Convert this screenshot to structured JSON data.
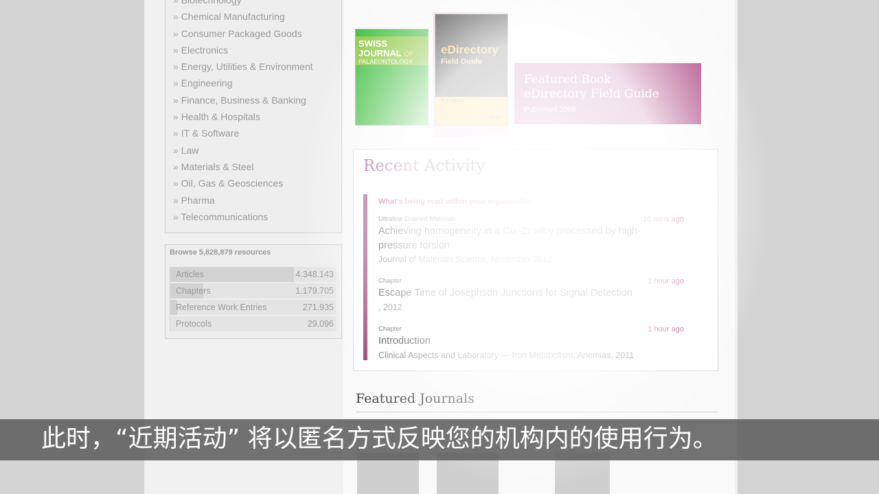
{
  "sidebar": {
    "categories": [
      "Biotechnology",
      "Chemical Manufacturing",
      "Consumer Packaged Goods",
      "Electronics",
      "Energy, Utilities & Environment",
      "Engineering",
      "Finance, Business & Banking",
      "Health & Hospitals",
      "IT & Software",
      "Law",
      "Materials & Steel",
      "Oil, Gas & Geosciences",
      "Pharma",
      "Telecommunications"
    ],
    "browse": {
      "title": "Browse 5,828,879 resources",
      "rows": [
        {
          "label": "Articles",
          "count": "4.348.143",
          "share": 0.746
        },
        {
          "label": "Chapters",
          "count": "1.179.705",
          "share": 0.202
        },
        {
          "label": "Reference Work Entries",
          "count": "271.935",
          "share": 0.047
        },
        {
          "label": "Protocols",
          "count": "29.096",
          "share": 0.005
        }
      ]
    }
  },
  "covers": {
    "swiss": {
      "line1": "SWISS",
      "line2": "JOURNAL",
      "line3": "OF",
      "line4": "PALAEONTOLOGY"
    },
    "edirectory": {
      "title": "eDirectory",
      "subtitle": "Field Guide",
      "author": "Rick Killpack",
      "publisher": "Apress"
    }
  },
  "featured": {
    "heading": "Featured Book",
    "title": "eDirectory Field Guide",
    "published": "Published 2006",
    "color": "#a43576"
  },
  "recent": {
    "title_accent": "Recent",
    "title_rest": "Activity",
    "subheading": "What's being read within your organisation",
    "items": [
      {
        "kind": "Ultrafine Grained Materials",
        "time": "10 mins ago",
        "title": "Achieving homogeneity in a Cu–Zr alloy processed by high-pressure torsion",
        "source": "Journal of Materials Science, November 2012"
      },
      {
        "kind": "Chapter",
        "time": "1 hour ago",
        "title": "Escape Time of Josephson Junctions for Signal Detection",
        "source": ", 2012"
      },
      {
        "kind": "Chapter",
        "time": "1 hour ago",
        "title": "Introduction",
        "source": "Clinical Aspects and Laboratory — Iron Metabolism, Anemias, 2011"
      }
    ],
    "accent_color": "#9a2d6c"
  },
  "featured_journals": {
    "title": "Featured Journals"
  },
  "caption": "此时，“近期活动” 将以匿名方式反映您的机构内的使用行为。"
}
